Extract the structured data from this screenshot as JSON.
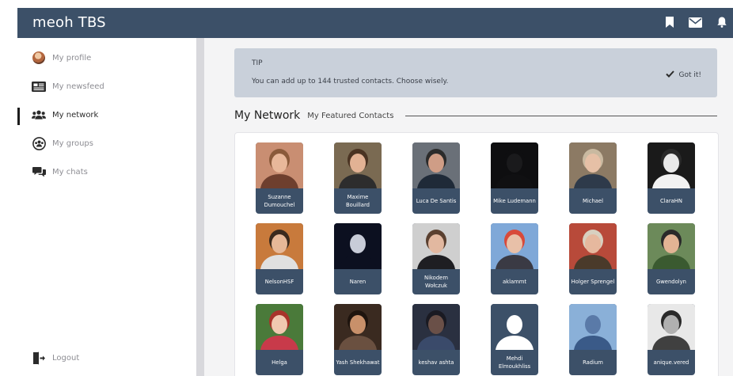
{
  "app": {
    "brand": "meoh TBS"
  },
  "topbar": {
    "icons": [
      "bookmark-icon",
      "mail-icon",
      "bell-icon"
    ]
  },
  "sidebar": {
    "items": [
      {
        "label": "My profile",
        "icon": "avatar"
      },
      {
        "label": "My newsfeed",
        "icon": "newspaper-icon"
      },
      {
        "label": "My network",
        "icon": "users-icon",
        "active": true
      },
      {
        "label": "My groups",
        "icon": "group-icon"
      },
      {
        "label": "My chats",
        "icon": "chats-icon"
      }
    ],
    "logout": "Logout"
  },
  "tip": {
    "title": "TIP",
    "text": "You can add up to 144 trusted contacts. Choose wisely.",
    "button": "Got it!"
  },
  "network": {
    "title": "My Network",
    "subtitle": "My Featured Contacts",
    "contacts": [
      {
        "name": "Suzanne Dumouchel",
        "bg": "#c98e72",
        "face": "#e8b89a",
        "hair": "#8a5a3a",
        "shirt": "#6e3f2e"
      },
      {
        "name": "Maxime Bouillard",
        "bg": "#7a6a52",
        "face": "#e2b294",
        "hair": "#4a3322",
        "shirt": "#2d2d2d"
      },
      {
        "name": "Luca De Santis",
        "bg": "#6a7078",
        "face": "#cf9d86",
        "hair": "#2b2b2b",
        "shirt": "#1f2a38"
      },
      {
        "name": "Mike Ludemann",
        "bg": "#0e0e10",
        "face": "#1a1a1c",
        "hair": "#0e0e10",
        "shirt": "#101012"
      },
      {
        "name": "Michael",
        "bg": "#8c7a64",
        "face": "#e6c0a6",
        "hair": "#c9b9a0",
        "shirt": "#2e3a4a"
      },
      {
        "name": "ClaraHN",
        "bg": "#1a1a1a",
        "face": "#e9e9e9",
        "hair": "#2a2a2a",
        "shirt": "#f2f2f2"
      },
      {
        "name": "NelsonHSF",
        "bg": "#c87a3c",
        "face": "#e6b898",
        "hair": "#3a2a1e",
        "shirt": "#e0e0e0"
      },
      {
        "name": "Naren",
        "bg": "#0c1020",
        "face": "#c8ccd8",
        "hair": "#0c1020",
        "shirt": "#0c1020"
      },
      {
        "name": "Nikodem Wołczuk",
        "bg": "#cfcfcf",
        "face": "#e2b8a0",
        "hair": "#5a4030",
        "shirt": "#1e1e22"
      },
      {
        "name": "aklammt",
        "bg": "#7fa8d8",
        "face": "#e8c0a8",
        "hair": "#d84a3a",
        "shirt": "#3a3a44"
      },
      {
        "name": "Holger Sprengel",
        "bg": "#b84a3a",
        "face": "#e6b89e",
        "hair": "#d8d0c0",
        "shirt": "#4a3a2a"
      },
      {
        "name": "Gwendolyn",
        "bg": "#6c8a5a",
        "face": "#e2b494",
        "hair": "#2a2a2a",
        "shirt": "#3a5a30"
      },
      {
        "name": "Helga",
        "bg": "#4a7a3a",
        "face": "#f0c8b0",
        "hair": "#a8332a",
        "shirt": "#c83a4a"
      },
      {
        "name": "Yash Shekhawat",
        "bg": "#3a2a20",
        "face": "#c8906a",
        "hair": "#1e140e",
        "shirt": "#6a5040"
      },
      {
        "name": "keshav ashta",
        "bg": "#2a3040",
        "face": "#6a5048",
        "hair": "#1a1a22",
        "shirt": "#3a4a6a"
      },
      {
        "name": "Mehdi Elmoukhliss",
        "bg": "#3c5068",
        "face": "#ffffff",
        "hair": "#3c5068",
        "shirt": "#ffffff"
      },
      {
        "name": "Radium",
        "bg": "#8ab0d8",
        "face": "#5a7aa8",
        "hair": "#8ab0d8",
        "shirt": "#3a5a88"
      },
      {
        "name": "anique.vered",
        "bg": "#e8e8e8",
        "face": "#b0b0b0",
        "hair": "#2a2a2a",
        "shirt": "#404040"
      }
    ]
  },
  "colors": {
    "topbar": "#3c5068",
    "tip_bg": "#c9d0da",
    "card_label": "#3c5068"
  }
}
